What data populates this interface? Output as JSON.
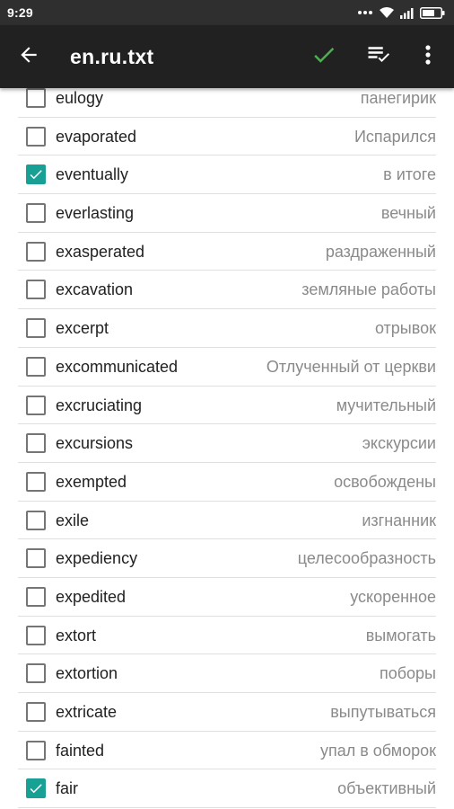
{
  "status_bar": {
    "time": "9:29",
    "icons": [
      "signal-dots-icon",
      "wifi-icon",
      "cellular-signal-icon",
      "battery-icon"
    ]
  },
  "app_bar": {
    "title": "en.ru.txt",
    "back_icon": "arrow-left-icon",
    "confirm_icon": "check-icon",
    "select_all_icon": "playlist-check-icon",
    "overflow_icon": "more-vert-icon",
    "confirm_color": "#4caf50"
  },
  "colors": {
    "checkbox_checked": "#17a093",
    "app_bar": "#212121",
    "status_bar": "#2f2f2f"
  },
  "words": [
    {
      "word": "eulogy",
      "translation": "панегирик",
      "checked": false
    },
    {
      "word": "evaporated",
      "translation": "Испарился",
      "checked": false
    },
    {
      "word": "eventually",
      "translation": "в итоге",
      "checked": true
    },
    {
      "word": "everlasting",
      "translation": "вечный",
      "checked": false
    },
    {
      "word": "exasperated",
      "translation": "раздраженный",
      "checked": false
    },
    {
      "word": "excavation",
      "translation": "земляные работы",
      "checked": false
    },
    {
      "word": "excerpt",
      "translation": "отрывок",
      "checked": false
    },
    {
      "word": "excommunicated",
      "translation": "Отлученный от церкви",
      "checked": false
    },
    {
      "word": "excruciating",
      "translation": "мучительный",
      "checked": false
    },
    {
      "word": "excursions",
      "translation": "экскурсии",
      "checked": false
    },
    {
      "word": "exempted",
      "translation": "освобождены",
      "checked": false
    },
    {
      "word": "exile",
      "translation": "изгнанник",
      "checked": false
    },
    {
      "word": "expediency",
      "translation": "целесообразность",
      "checked": false
    },
    {
      "word": "expedited",
      "translation": "ускоренное",
      "checked": false
    },
    {
      "word": "extort",
      "translation": "вымогать",
      "checked": false
    },
    {
      "word": "extortion",
      "translation": "поборы",
      "checked": false
    },
    {
      "word": "extricate",
      "translation": "выпутываться",
      "checked": false
    },
    {
      "word": "fainted",
      "translation": "упал в обморок",
      "checked": false
    },
    {
      "word": "fair",
      "translation": "объективный",
      "checked": true
    }
  ]
}
